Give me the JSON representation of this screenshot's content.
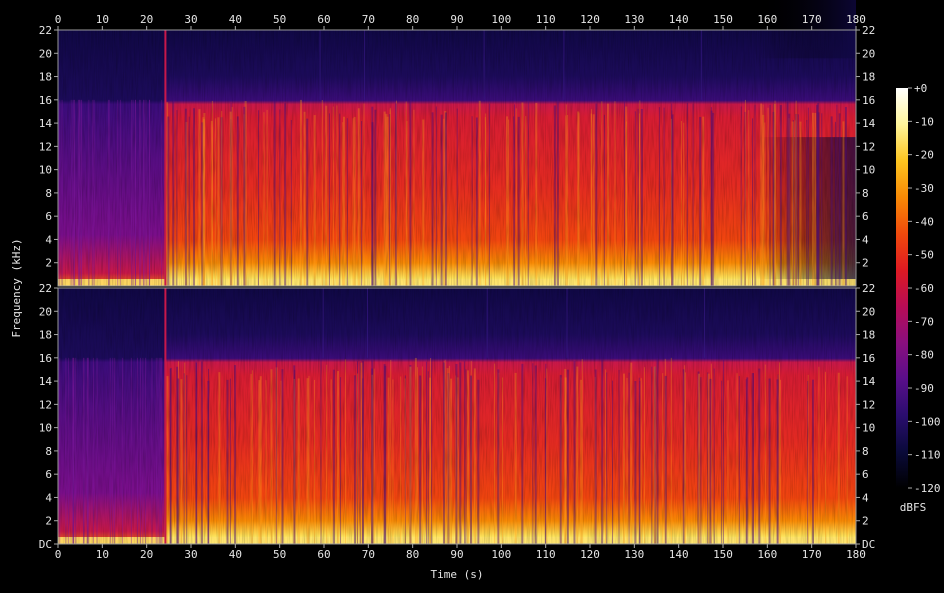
{
  "chart_data": {
    "type": "heatmap",
    "subtype": "spectrogram",
    "xlabel": "Time (s)",
    "ylabel": "Frequency (kHz)",
    "x_ticks": [
      0,
      10,
      20,
      30,
      40,
      50,
      60,
      70,
      80,
      90,
      100,
      110,
      120,
      130,
      140,
      150,
      160,
      170,
      180
    ],
    "xlim": [
      0,
      180
    ],
    "y_tick_labels": [
      "DC",
      "2",
      "4",
      "6",
      "8",
      "10",
      "12",
      "14",
      "16",
      "18",
      "20",
      "22"
    ],
    "ylim_khz": [
      0,
      22
    ],
    "channels": 2,
    "colorbar": {
      "label": "dBFS",
      "ticks": [
        "+0",
        "-10",
        "-20",
        "-30",
        "-40",
        "-50",
        "-60",
        "-70",
        "-80",
        "-90",
        "-100",
        "-110",
        "-120"
      ],
      "range_db": [
        -120,
        0
      ],
      "colors": [
        "#000000",
        "#0a0a3a",
        "#2a0d6e",
        "#5a0e8a",
        "#8a0f7e",
        "#b80c55",
        "#de1a22",
        "#f04a0c",
        "#f88a05",
        "#fdc520",
        "#fff59a",
        "#ffffff"
      ]
    },
    "content_summary": {
      "lowpass_cutoff_khz": 16,
      "intro_end_s": 24,
      "outro_start_s": 158,
      "end_s": 180,
      "loud_section_db": -55,
      "quiet_section_db": -85,
      "band_above_cutoff_db": -105
    }
  }
}
